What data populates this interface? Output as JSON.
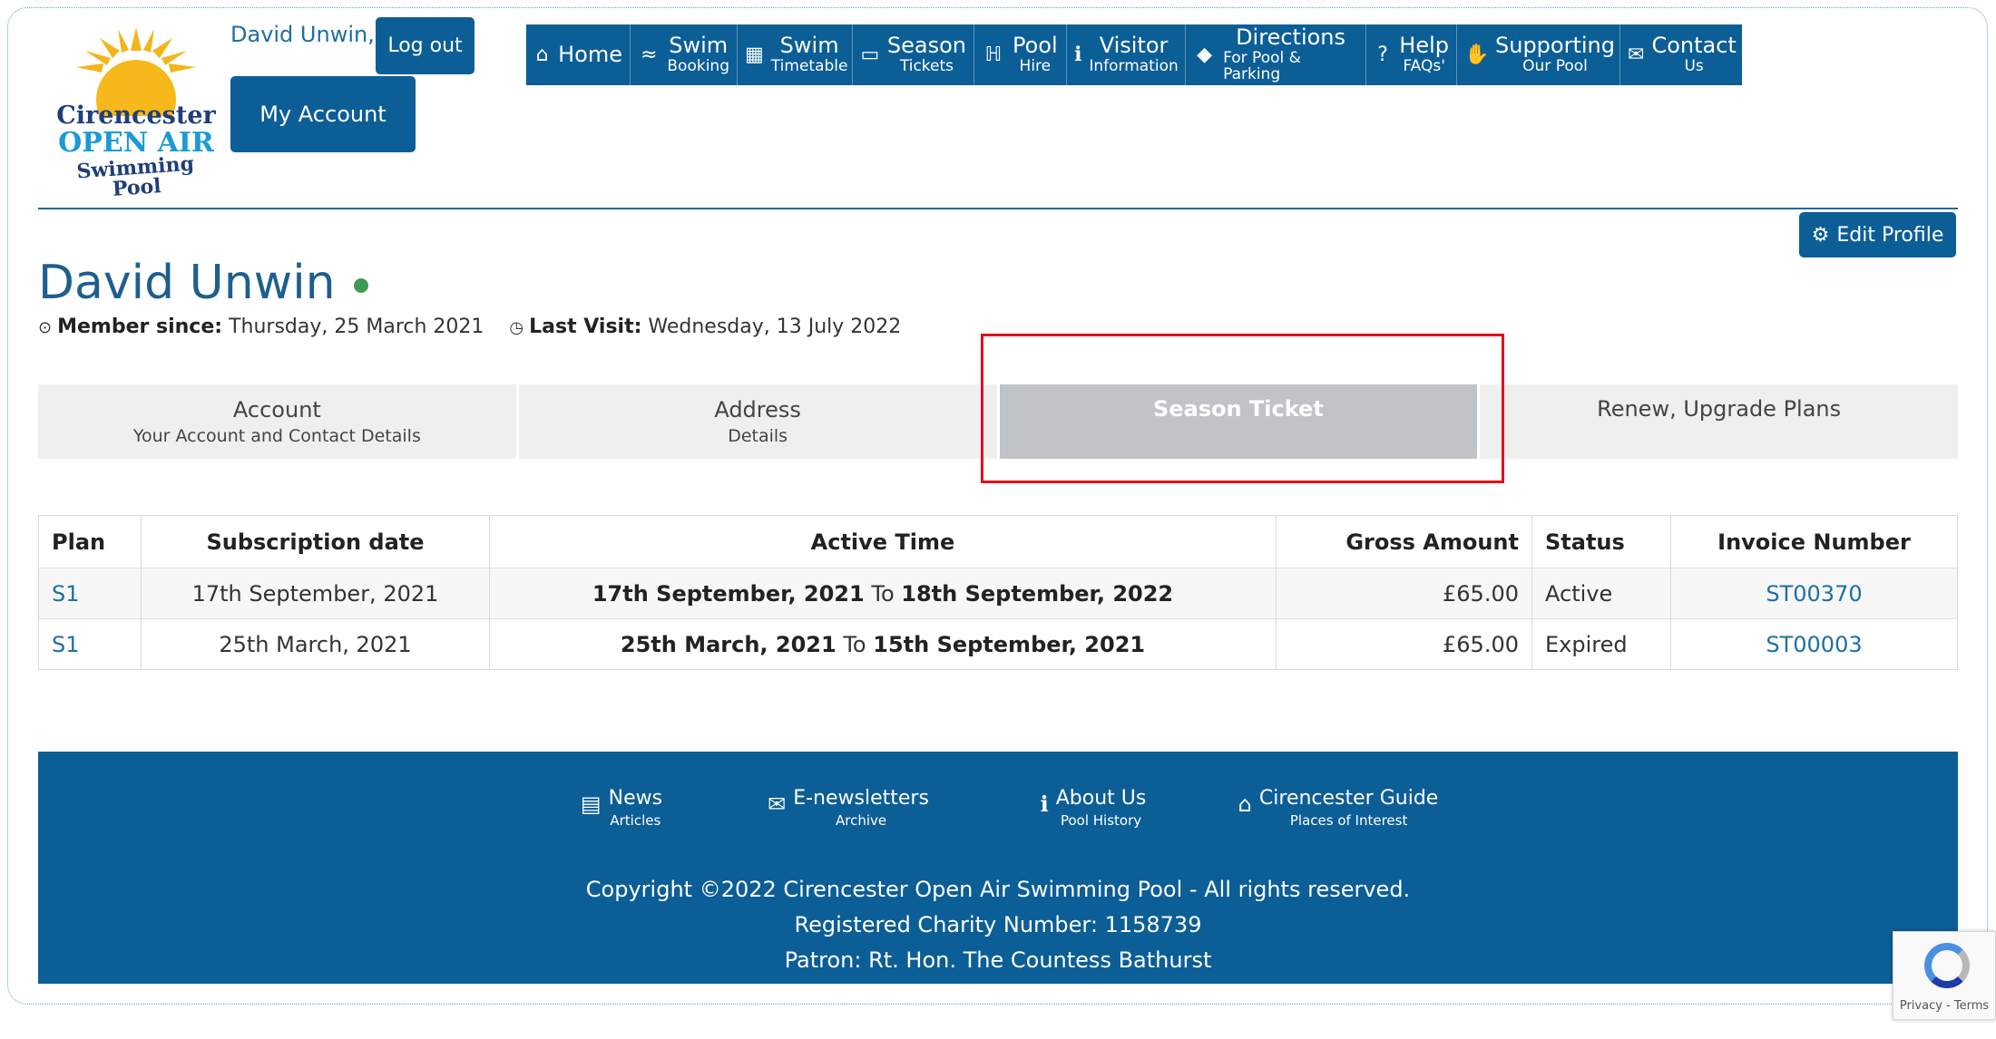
{
  "header": {
    "logo": {
      "line1": "Cirencester",
      "line2": "OPEN AIR",
      "line3": "Swimming Pool"
    },
    "user_greeting": "David Unwin,",
    "logout_label": "Log out",
    "my_account_label": "My Account"
  },
  "nav": [
    {
      "top": "Home",
      "sub": "",
      "icon": "home-icon"
    },
    {
      "top": "Swim",
      "sub": "Booking",
      "icon": "swimmer-icon"
    },
    {
      "top": "Swim",
      "sub": "Timetable",
      "icon": "calendar-icon"
    },
    {
      "top": "Season",
      "sub": "Tickets",
      "icon": "id-card-icon"
    },
    {
      "top": "Pool",
      "sub": "Hire",
      "icon": "pool-ladder-icon"
    },
    {
      "top": "Visitor",
      "sub": "Information",
      "icon": "info-icon"
    },
    {
      "top": "Directions",
      "sub": "For Pool & Parking",
      "icon": "direction-sign-icon"
    },
    {
      "top": "Help",
      "sub": "FAQs'",
      "icon": "question-icon"
    },
    {
      "top": "Supporting",
      "sub": "Our Pool",
      "icon": "handshake-icon"
    },
    {
      "top": "Contact",
      "sub": "Us",
      "icon": "envelope-icon"
    }
  ],
  "profile": {
    "edit_label": "Edit Profile",
    "name": "David Unwin",
    "member_since_label": "Member since:",
    "member_since_value": "Thursday, 25 March 2021",
    "last_visit_label": "Last Visit:",
    "last_visit_value": "Wednesday, 13 July 2022"
  },
  "tabs": [
    {
      "title": "Account",
      "sub": "Your Account and Contact Details"
    },
    {
      "title": "Address",
      "sub": "Details"
    },
    {
      "title": "Season Ticket",
      "sub": ""
    },
    {
      "title": "Renew, Upgrade Plans",
      "sub": ""
    }
  ],
  "table": {
    "headers": [
      "Plan",
      "Subscription date",
      "Active Time",
      "Gross Amount",
      "Status",
      "Invoice Number"
    ],
    "rows": [
      {
        "plan": "S1",
        "sub_date": "17th September, 2021",
        "active_from": "17th September, 2021",
        "to": "To",
        "active_to": "18th September, 2022",
        "gross": "£65.00",
        "status": "Active",
        "invoice": "ST00370"
      },
      {
        "plan": "S1",
        "sub_date": "25th March, 2021",
        "active_from": "25th March, 2021",
        "to": "To",
        "active_to": "15th September, 2021",
        "gross": "£65.00",
        "status": "Expired",
        "invoice": "ST00003"
      }
    ]
  },
  "footer": {
    "links": [
      {
        "top": "News",
        "sub": "Articles",
        "icon": "newspaper-icon"
      },
      {
        "top": "E-newsletters",
        "sub": "Archive",
        "icon": "mail-archive-icon"
      },
      {
        "top": "About Us",
        "sub": "Pool History",
        "icon": "info-icon"
      },
      {
        "top": "Cirencester Guide",
        "sub": "Places of Interest",
        "icon": "landmark-icon"
      }
    ],
    "copyright": "Copyright ©2022 Cirencester Open Air Swimming Pool - All rights reserved.",
    "charity": "Registered Charity Number: 1158739",
    "patron": "Patron: Rt. Hon. The Countess Bathurst"
  },
  "recaptcha": {
    "text": "Privacy - Terms"
  },
  "colors": {
    "brand_blue": "#0c5e96",
    "link_blue": "#1d6fa5",
    "highlight_red": "#e0111a",
    "online_green": "#3f9b52"
  }
}
